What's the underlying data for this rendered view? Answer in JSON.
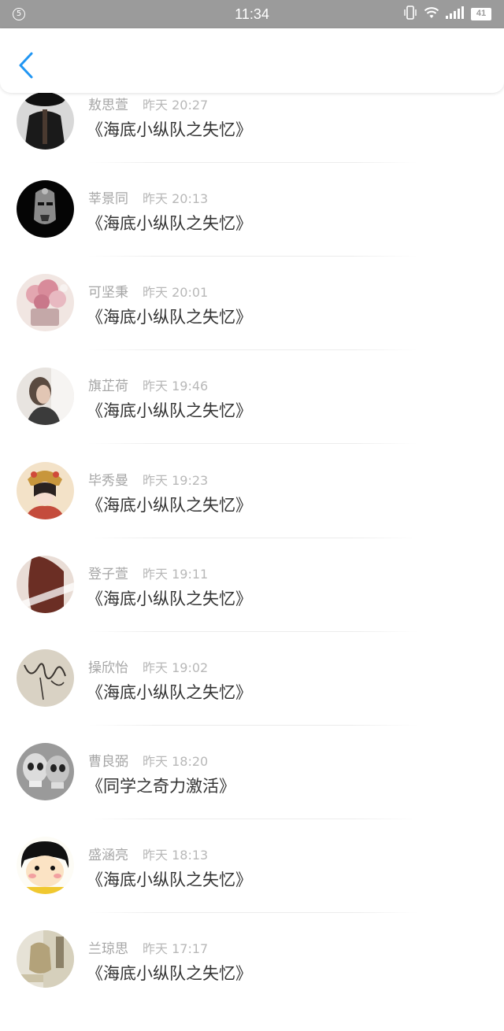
{
  "status_bar": {
    "notification_count": "5",
    "time": "11:34",
    "battery": "41",
    "icons": [
      "vibrate-icon",
      "wifi-icon",
      "signal-icon",
      "battery-icon"
    ]
  },
  "header": {
    "back_icon": "chevron-left-icon",
    "accent_color": "#2196f3"
  },
  "items": [
    {
      "name": "敖思萱",
      "time": "昨天 20:27",
      "title": "《海底小纵队之失忆》"
    },
    {
      "name": "莘景同",
      "time": "昨天 20:13",
      "title": "《海底小纵队之失忆》"
    },
    {
      "name": "可坚秉",
      "time": "昨天 20:01",
      "title": "《海底小纵队之失忆》"
    },
    {
      "name": "旗芷荷",
      "time": "昨天 19:46",
      "title": "《海底小纵队之失忆》"
    },
    {
      "name": "毕秀曼",
      "time": "昨天 19:23",
      "title": "《海底小纵队之失忆》"
    },
    {
      "name": "登子萱",
      "time": "昨天 19:11",
      "title": "《海底小纵队之失忆》"
    },
    {
      "name": "操欣怡",
      "time": "昨天 19:02",
      "title": "《海底小纵队之失忆》"
    },
    {
      "name": "曹良弼",
      "time": "昨天 18:20",
      "title": "《同学之奇力激活》"
    },
    {
      "name": "盛涵亮",
      "time": "昨天 18:13",
      "title": "《海底小纵队之失忆》"
    },
    {
      "name": "兰琼思",
      "time": "昨天 17:17",
      "title": "《海底小纵队之失忆》"
    }
  ]
}
